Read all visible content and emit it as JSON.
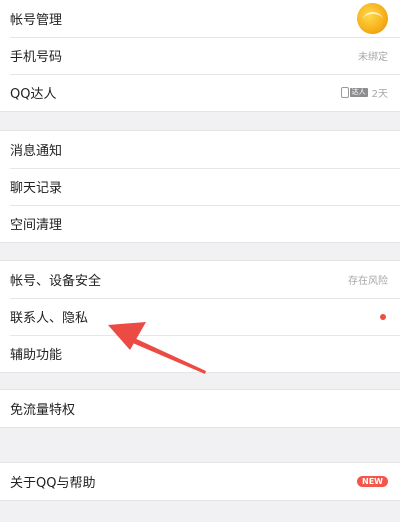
{
  "account": {
    "label": "帐号管理",
    "avatar_icon": "user-avatar",
    "phone_label": "手机号码",
    "phone_value": "未绑定",
    "talent_label": "QQ达人",
    "talent_icon": "qq-talent-phone-icon",
    "talent_badge": "达人",
    "talent_value": "2天"
  },
  "general": {
    "notifications_label": "消息通知",
    "chat_history_label": "聊天记录",
    "storage_cleanup_label": "空间清理"
  },
  "security": {
    "account_security_label": "帐号、设备安全",
    "account_security_status": "存在风险",
    "contacts_privacy_label": "联系人、隐私",
    "accessibility_label": "辅助功能"
  },
  "data_free": {
    "label": "免流量特权"
  },
  "about": {
    "label": "关于QQ与帮助",
    "badge": "NEW"
  },
  "colors": {
    "background": "#f1f1f4",
    "row_background": "#ffffff",
    "accent_red": "#f3564a",
    "annotation_arrow": "#ec4b44"
  }
}
